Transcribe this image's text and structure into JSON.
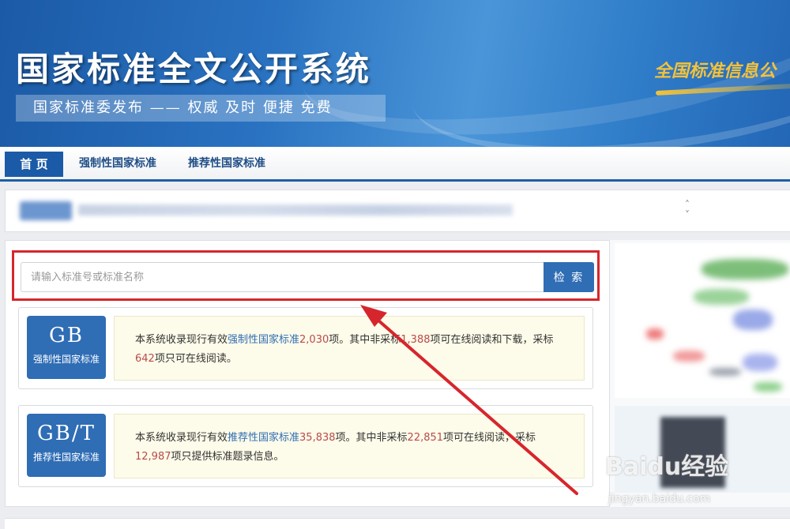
{
  "banner": {
    "title": "国家标准全文公开系统",
    "subtitle": "国家标准委发布 —— 权威 及时 便捷 免费",
    "slogan": "全国标准信息公"
  },
  "nav": {
    "items": [
      {
        "label": "首 页",
        "active": true
      },
      {
        "label": "强制性国家标准",
        "active": false
      },
      {
        "label": "推荐性国家标准",
        "active": false
      }
    ]
  },
  "search": {
    "placeholder": "请输入标准号或标准名称",
    "button_label": "检 索"
  },
  "cards": [
    {
      "code": "GB",
      "label": "强制性国家标准",
      "desc_prefix": "本系统收录现行有效",
      "desc_link": "强制性国家标准",
      "desc_total": "2,030",
      "desc_mid1": "项。其中非采标",
      "desc_nonadopted": "1,388",
      "desc_mid2": "项可在线阅读和下载，采标",
      "desc_adopted": "642",
      "desc_suffix": "项只可在线阅读。"
    },
    {
      "code": "GB/T",
      "label": "推荐性国家标准",
      "desc_prefix": "本系统收录现行有效",
      "desc_link": "推荐性国家标准",
      "desc_total": "35,838",
      "desc_mid1": "项。其中非采标",
      "desc_nonadopted": "22,851",
      "desc_mid2": "项可在线阅读，采标",
      "desc_adopted": "12,987",
      "desc_suffix": "项只提供标准题录信息。"
    }
  ],
  "watermark": {
    "brand": "Baidu经验",
    "url": "jingyan.baidu.com"
  },
  "colors": {
    "primary": "#2f6db5",
    "highlight_box": "#d6262d",
    "number": "#b84b4b",
    "desc_bg": "#fdfbe9"
  }
}
